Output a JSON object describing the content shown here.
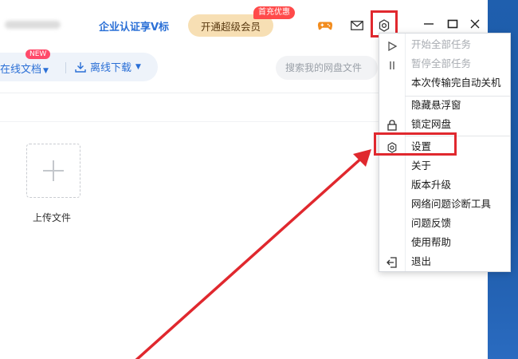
{
  "titlebar": {
    "vip_link": "企业认证享V标",
    "super_vip_button": "开通超级会员",
    "first_charge_badge": "首充优惠"
  },
  "toolbar": {
    "online_docs": "在线文档",
    "new_badge": "NEW",
    "offline_download": "离线下载",
    "search_placeholder": "搜索我的网盘文件"
  },
  "main": {
    "upload_label": "上传文件"
  },
  "menu": {
    "items": [
      {
        "label": "开始全部任务",
        "enabled": false,
        "icon": "play-icon"
      },
      {
        "label": "暂停全部任务",
        "enabled": false,
        "icon": "pause-icon"
      },
      {
        "label": "本次传输完自动关机",
        "enabled": true,
        "icon": ""
      },
      {
        "label": "隐藏悬浮窗",
        "enabled": true,
        "icon": ""
      },
      {
        "label": "锁定网盘",
        "enabled": true,
        "icon": "lock-icon"
      },
      {
        "label": "设置",
        "enabled": true,
        "icon": "gear-icon"
      },
      {
        "label": "关于",
        "enabled": true,
        "icon": ""
      },
      {
        "label": "版本升级",
        "enabled": true,
        "icon": ""
      },
      {
        "label": "网络问题诊断工具",
        "enabled": true,
        "icon": ""
      },
      {
        "label": "问题反馈",
        "enabled": true,
        "icon": ""
      },
      {
        "label": "使用帮助",
        "enabled": true,
        "icon": ""
      },
      {
        "label": "退出",
        "enabled": true,
        "icon": "exit-icon"
      }
    ]
  },
  "colors": {
    "accent": "#2a6fd6",
    "highlight": "#e0282e",
    "vip_gold": "#f7dfb4"
  }
}
